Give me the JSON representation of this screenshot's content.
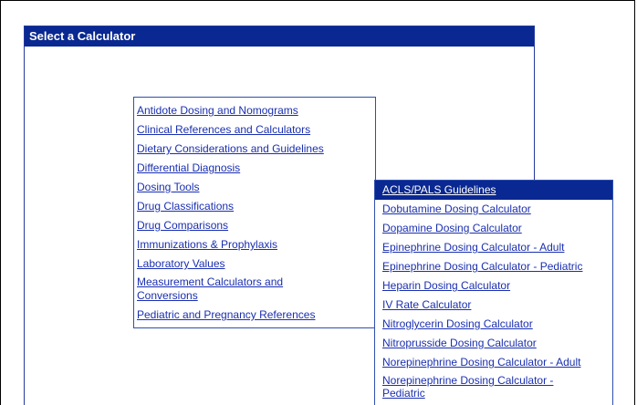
{
  "panel": {
    "title": "Select a Calculator"
  },
  "menu": {
    "items": [
      {
        "label": "Antidote Dosing and Nomograms"
      },
      {
        "label": "Clinical References and Calculators"
      },
      {
        "label": "Dietary Considerations and Guidelines"
      },
      {
        "label": "Differential Diagnosis"
      },
      {
        "label": "Dosing Tools"
      },
      {
        "label": "Drug Classifications"
      },
      {
        "label": "Drug Comparisons"
      },
      {
        "label": "Immunizations & Prophylaxis"
      },
      {
        "label": "Laboratory Values"
      },
      {
        "label": "Measurement Calculators and Conversions"
      },
      {
        "label": "Pediatric and Pregnancy References"
      }
    ]
  },
  "submenu": {
    "items": [
      {
        "label": "ACLS/PALS Guidelines"
      },
      {
        "label": "Dobutamine Dosing Calculator"
      },
      {
        "label": "Dopamine Dosing Calculator"
      },
      {
        "label": "Epinephrine Dosing Calculator - Adult"
      },
      {
        "label": "Epinephrine Dosing Calculator - Pediatric"
      },
      {
        "label": "Heparin Dosing Calculator"
      },
      {
        "label": "IV Rate Calculator"
      },
      {
        "label": "Nitroglycerin Dosing Calculator"
      },
      {
        "label": "Nitroprusside Dosing Calculator"
      },
      {
        "label": "Norepinephrine Dosing Calculator - Adult"
      },
      {
        "label": "Norepinephrine Dosing Calculator - Pediatric"
      }
    ]
  }
}
